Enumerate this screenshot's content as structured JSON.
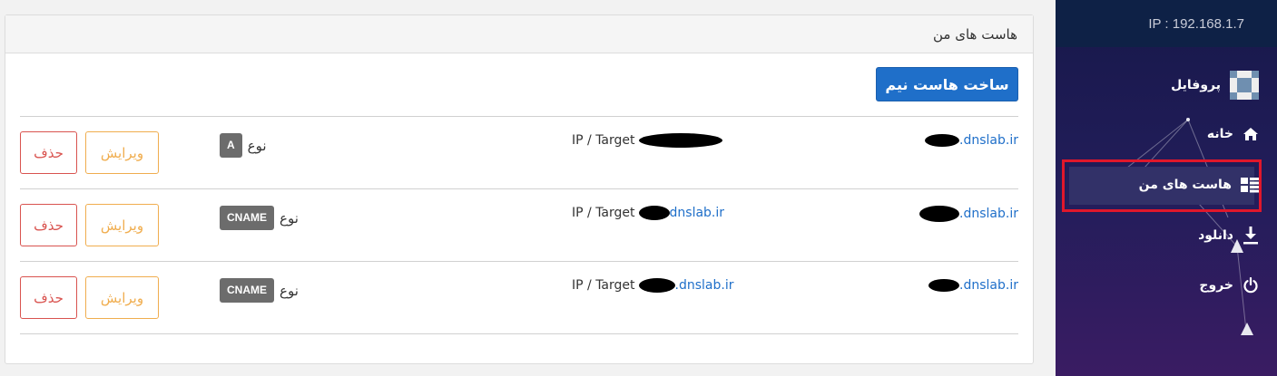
{
  "panel": {
    "title": "هاست های من",
    "create_button": "ساخت هاست نیم"
  },
  "labels": {
    "target": "IP / Target",
    "type": "نوع",
    "edit": "ویرایش",
    "delete": "حذف"
  },
  "records": [
    {
      "host": ".dnslab.ir",
      "target": "",
      "type": "A"
    },
    {
      "host": ".dnslab.ir",
      "target": "dnslab.ir",
      "type": "CNAME"
    },
    {
      "host": ".dnslab.ir",
      "target": ".dnslab.ir",
      "type": "CNAME"
    }
  ],
  "sidebar": {
    "ip": "IP : 192.168.1.7",
    "items": [
      {
        "label": "پروفایل",
        "icon": "avatar-icon"
      },
      {
        "label": "خانه",
        "icon": "home-icon"
      },
      {
        "label": "هاست های من",
        "icon": "list-icon",
        "active": true
      },
      {
        "label": "دانلود",
        "icon": "download-icon"
      },
      {
        "label": "خروج",
        "icon": "power-icon"
      }
    ],
    "accent_color": "#e0172b"
  },
  "colors": {
    "primary": "#1f6fc9",
    "danger": "#d9534f",
    "warning": "#f0ad4e"
  }
}
